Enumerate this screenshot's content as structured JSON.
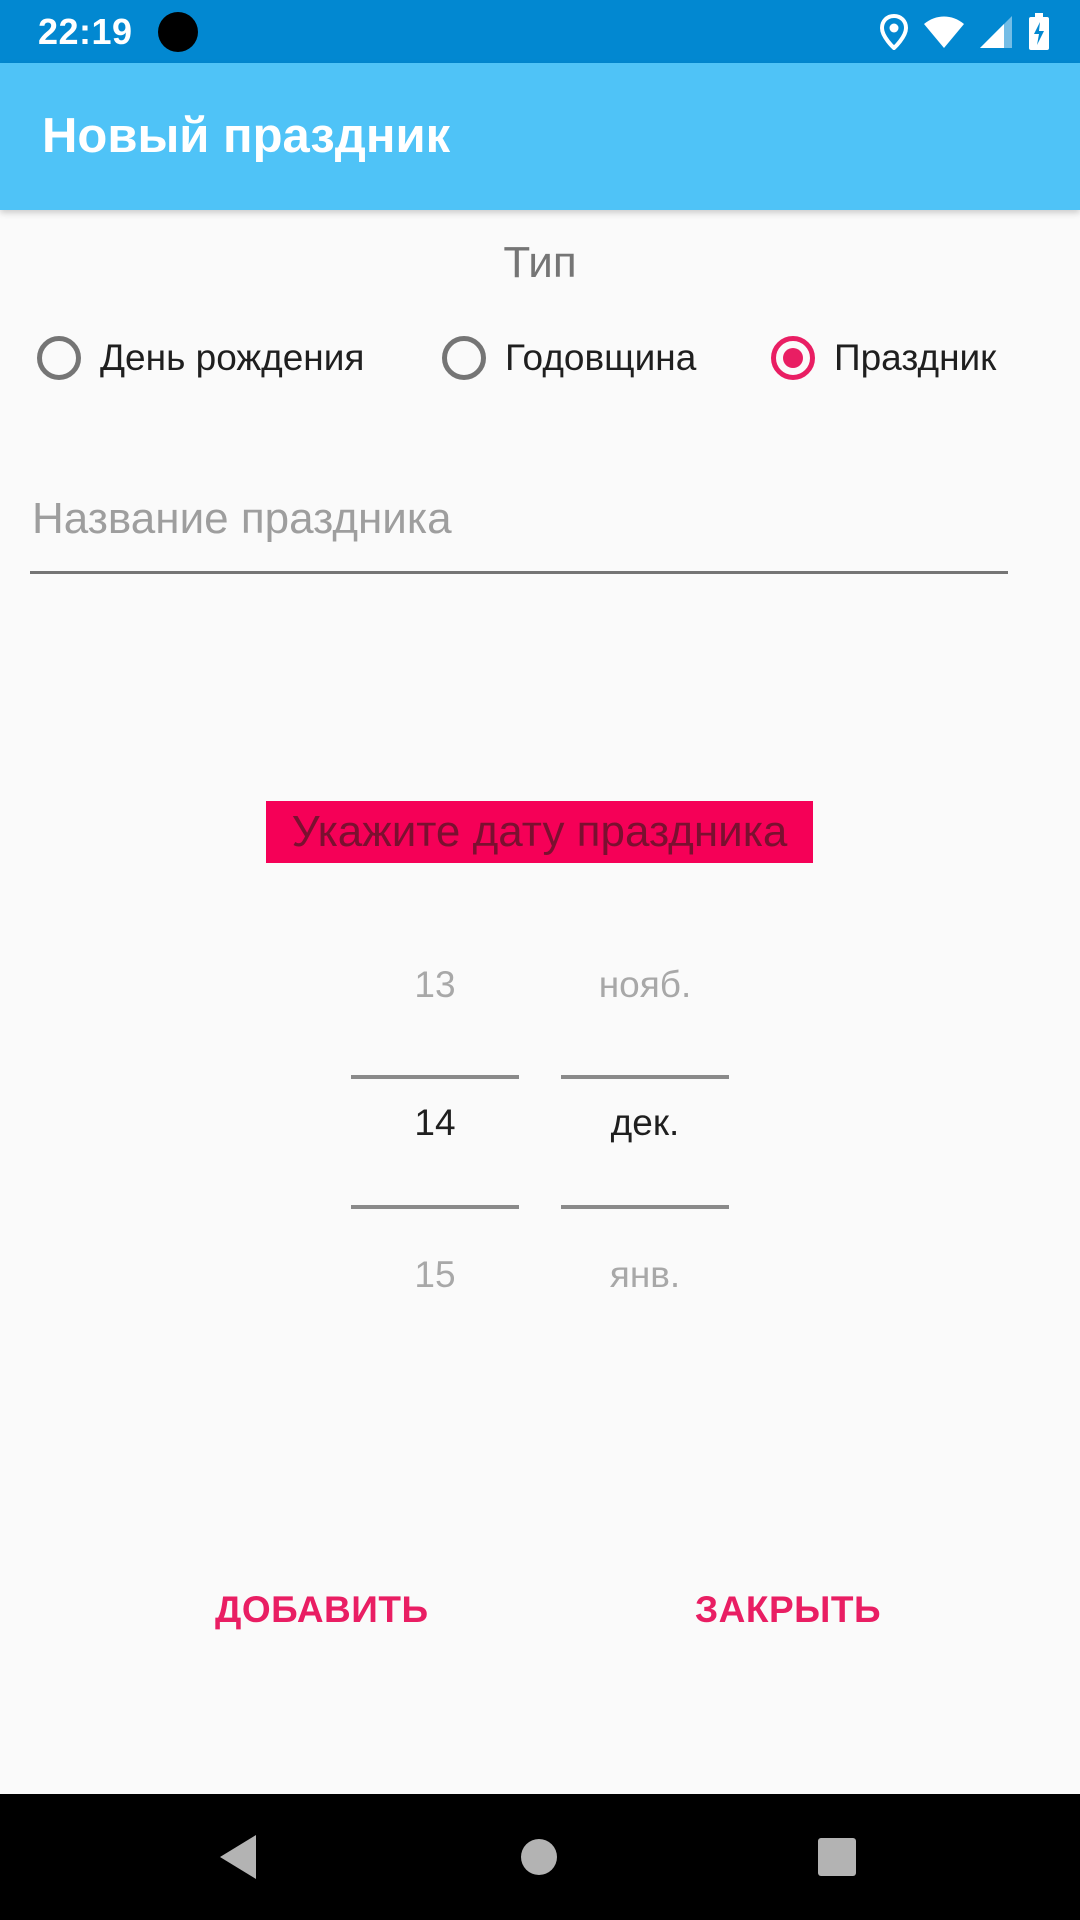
{
  "status_bar": {
    "time": "22:19",
    "icons": [
      "location-icon",
      "wifi-icon",
      "cell-signal-icon",
      "battery-icon"
    ]
  },
  "app_bar": {
    "title": "Новый праздник"
  },
  "type_section": {
    "label": "Тип",
    "options": [
      {
        "label": "День рождения",
        "checked": false
      },
      {
        "label": "Годовщина",
        "checked": false
      },
      {
        "label": "Праздник",
        "checked": true
      }
    ]
  },
  "name_field": {
    "value": "",
    "placeholder": "Название праздника"
  },
  "date_prompt": "Укажите дату праздника",
  "day_picker": {
    "prev": "13",
    "current": "14",
    "next": "15"
  },
  "month_picker": {
    "prev": "нояб.",
    "current": "дек.",
    "next": "янв."
  },
  "buttons": {
    "add": "ДОБАВИТЬ",
    "close": "ЗАКРЫТЬ"
  },
  "colors": {
    "status_bar": "#0288d1",
    "app_bar": "#4fc3f7",
    "accent": "#e91e63",
    "date_prompt_bg": "#f50057"
  },
  "nav_bar": {
    "icons": [
      "back-icon",
      "home-icon",
      "recent-apps-icon"
    ]
  }
}
